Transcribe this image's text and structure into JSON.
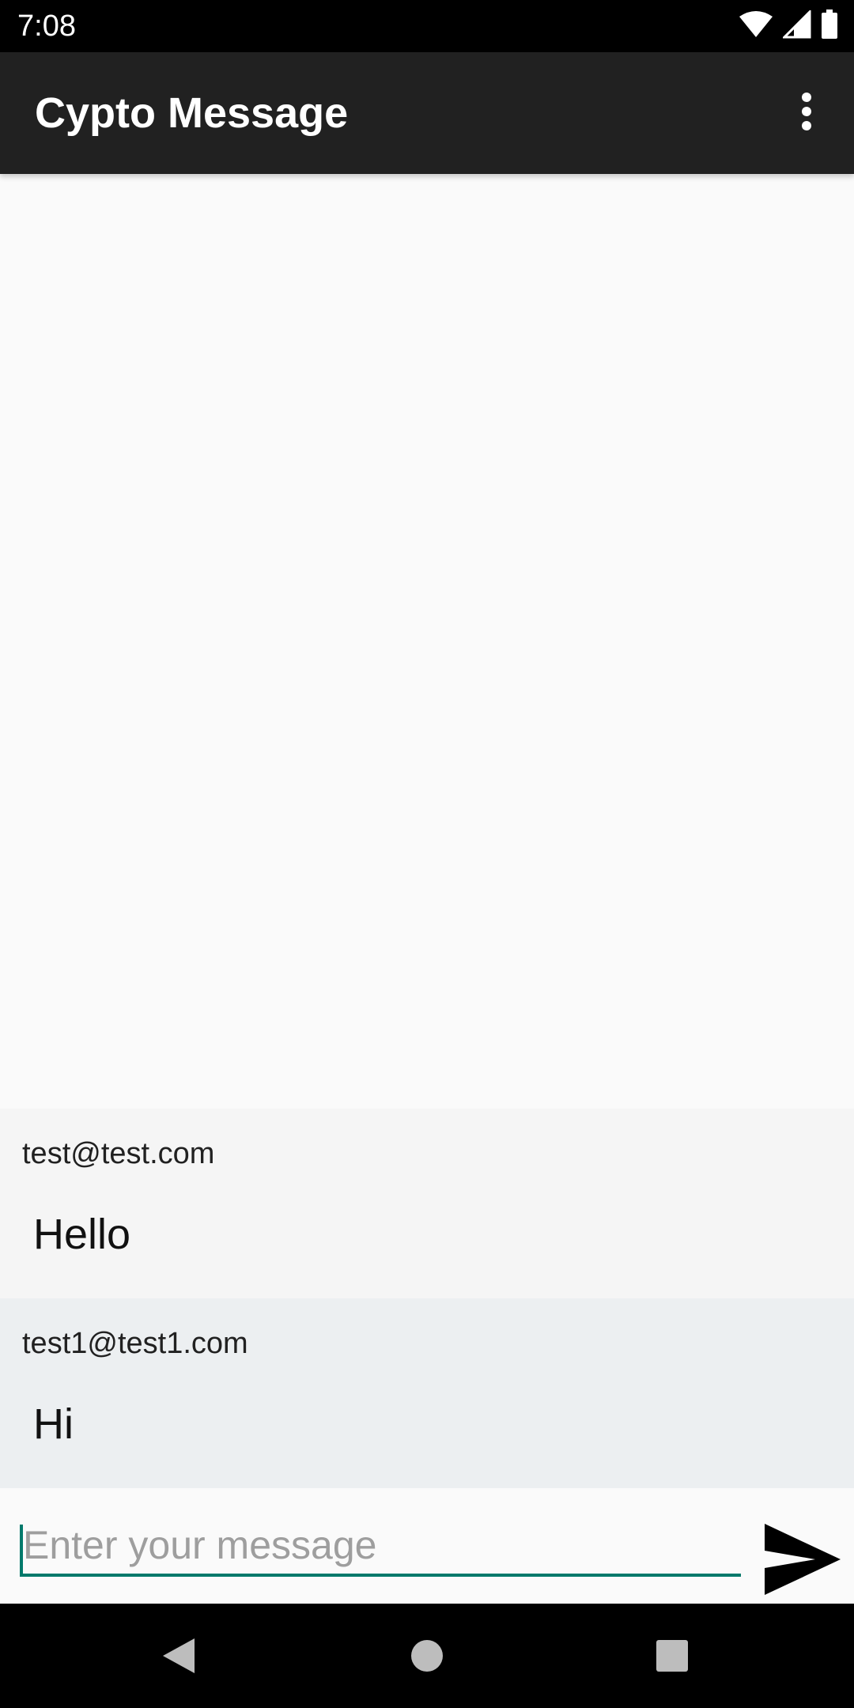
{
  "status_bar": {
    "time": "7:08",
    "icons": [
      "wifi-icon",
      "cellular-signal-icon",
      "battery-icon"
    ]
  },
  "app_bar": {
    "title": "Cypto Message",
    "menu_icon": "more-vert-icon"
  },
  "messages": [
    {
      "sender": "test@test.com",
      "text": "Hello"
    },
    {
      "sender": "test1@test1.com",
      "text": "Hi"
    }
  ],
  "composer": {
    "value": "",
    "placeholder": "Enter your message",
    "send_icon": "send-icon"
  },
  "nav_bar": {
    "buttons": [
      "back-icon",
      "home-icon",
      "recents-icon"
    ]
  },
  "colors": {
    "app_bar": "#212121",
    "accent": "#00796b",
    "message_bg_1": "#f5f5f5",
    "message_bg_2": "#eceff1",
    "background": "#fafafa"
  }
}
